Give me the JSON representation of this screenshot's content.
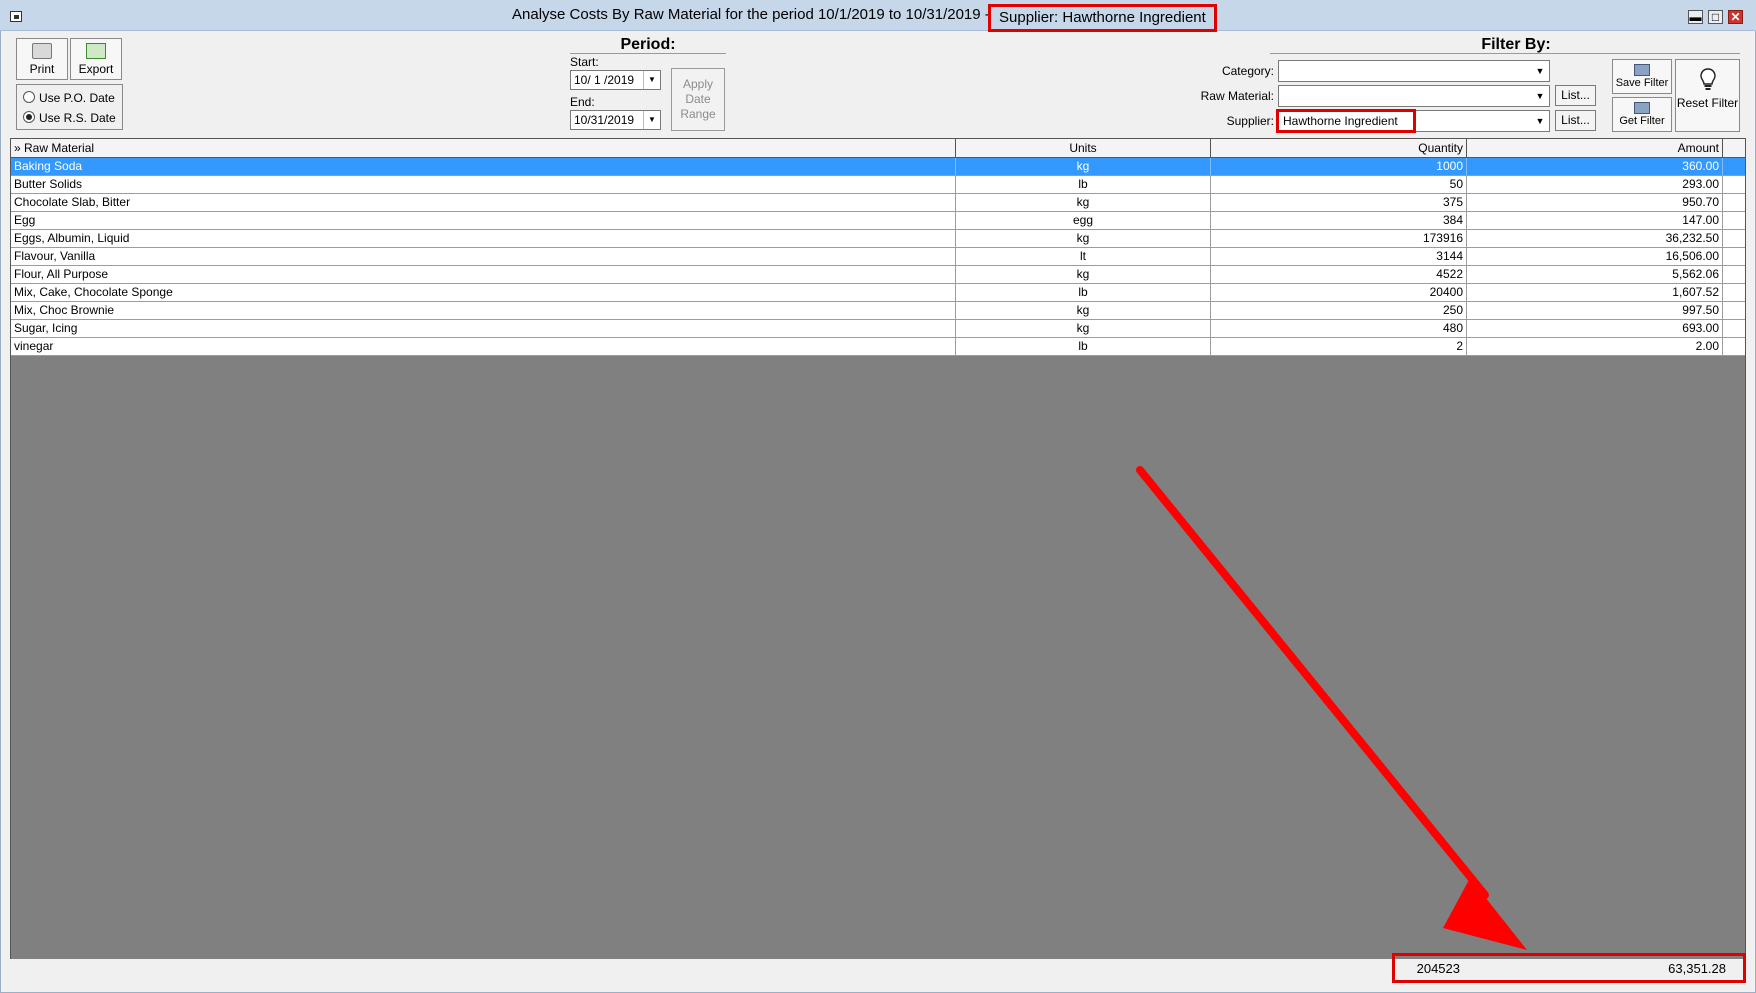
{
  "window": {
    "title": "Analyse Costs By Raw Material for the period 10/1/2019 to 10/31/2019 -",
    "title_supplier": "Supplier: Hawthorne Ingredient",
    "controls": {
      "minimize": "▬",
      "maximize": "□",
      "close": "✕"
    }
  },
  "toolbar": {
    "print_label": "Print",
    "export_label": "Export",
    "use_po_date": "Use P.O. Date",
    "use_rs_date": "Use R.S. Date",
    "selected_date_option": "Use R.S. Date"
  },
  "period": {
    "title": "Period:",
    "start_label": "Start:",
    "start_value": "10/ 1 /2019",
    "end_label": "End:",
    "end_value": "10/31/2019",
    "apply_label": "Apply Date Range"
  },
  "filter": {
    "title": "Filter By:",
    "category_label": "Category:",
    "category_value": "",
    "raw_material_label": "Raw Material:",
    "raw_material_value": "",
    "supplier_label": "Supplier:",
    "supplier_value": "Hawthorne Ingredient",
    "list_button": "List...",
    "save_filter": "Save Filter",
    "get_filter": "Get Filter",
    "reset_filter": "Reset Filter"
  },
  "table": {
    "columns": [
      "» Raw Material",
      "Units",
      "Quantity",
      "Amount"
    ],
    "rows": [
      {
        "material": "Baking Soda",
        "units": "kg",
        "quantity": "1000",
        "amount": "360.00"
      },
      {
        "material": "Butter Solids",
        "units": "lb",
        "quantity": "50",
        "amount": "293.00"
      },
      {
        "material": "Chocolate Slab, Bitter",
        "units": "kg",
        "quantity": "375",
        "amount": "950.70"
      },
      {
        "material": "Egg",
        "units": "egg",
        "quantity": "384",
        "amount": "147.00"
      },
      {
        "material": "Eggs, Albumin, Liquid",
        "units": "kg",
        "quantity": "173916",
        "amount": "36,232.50"
      },
      {
        "material": "Flavour, Vanilla",
        "units": "lt",
        "quantity": "3144",
        "amount": "16,506.00"
      },
      {
        "material": "Flour, All Purpose",
        "units": "kg",
        "quantity": "4522",
        "amount": "5,562.06"
      },
      {
        "material": "Mix, Cake, Chocolate Sponge",
        "units": "lb",
        "quantity": "20400",
        "amount": "1,607.52"
      },
      {
        "material": "Mix, Choc Brownie",
        "units": "kg",
        "quantity": "250",
        "amount": "997.50"
      },
      {
        "material": "Sugar, Icing",
        "units": "kg",
        "quantity": "480",
        "amount": "693.00"
      },
      {
        "material": "vinegar",
        "units": "lb",
        "quantity": "2",
        "amount": "2.00"
      }
    ],
    "selected_row": 0
  },
  "totals": {
    "quantity": "204523",
    "amount": "63,351.28"
  },
  "colors": {
    "highlight": "#e00000",
    "selection": "#3399ff",
    "grid_bg": "#808080"
  }
}
